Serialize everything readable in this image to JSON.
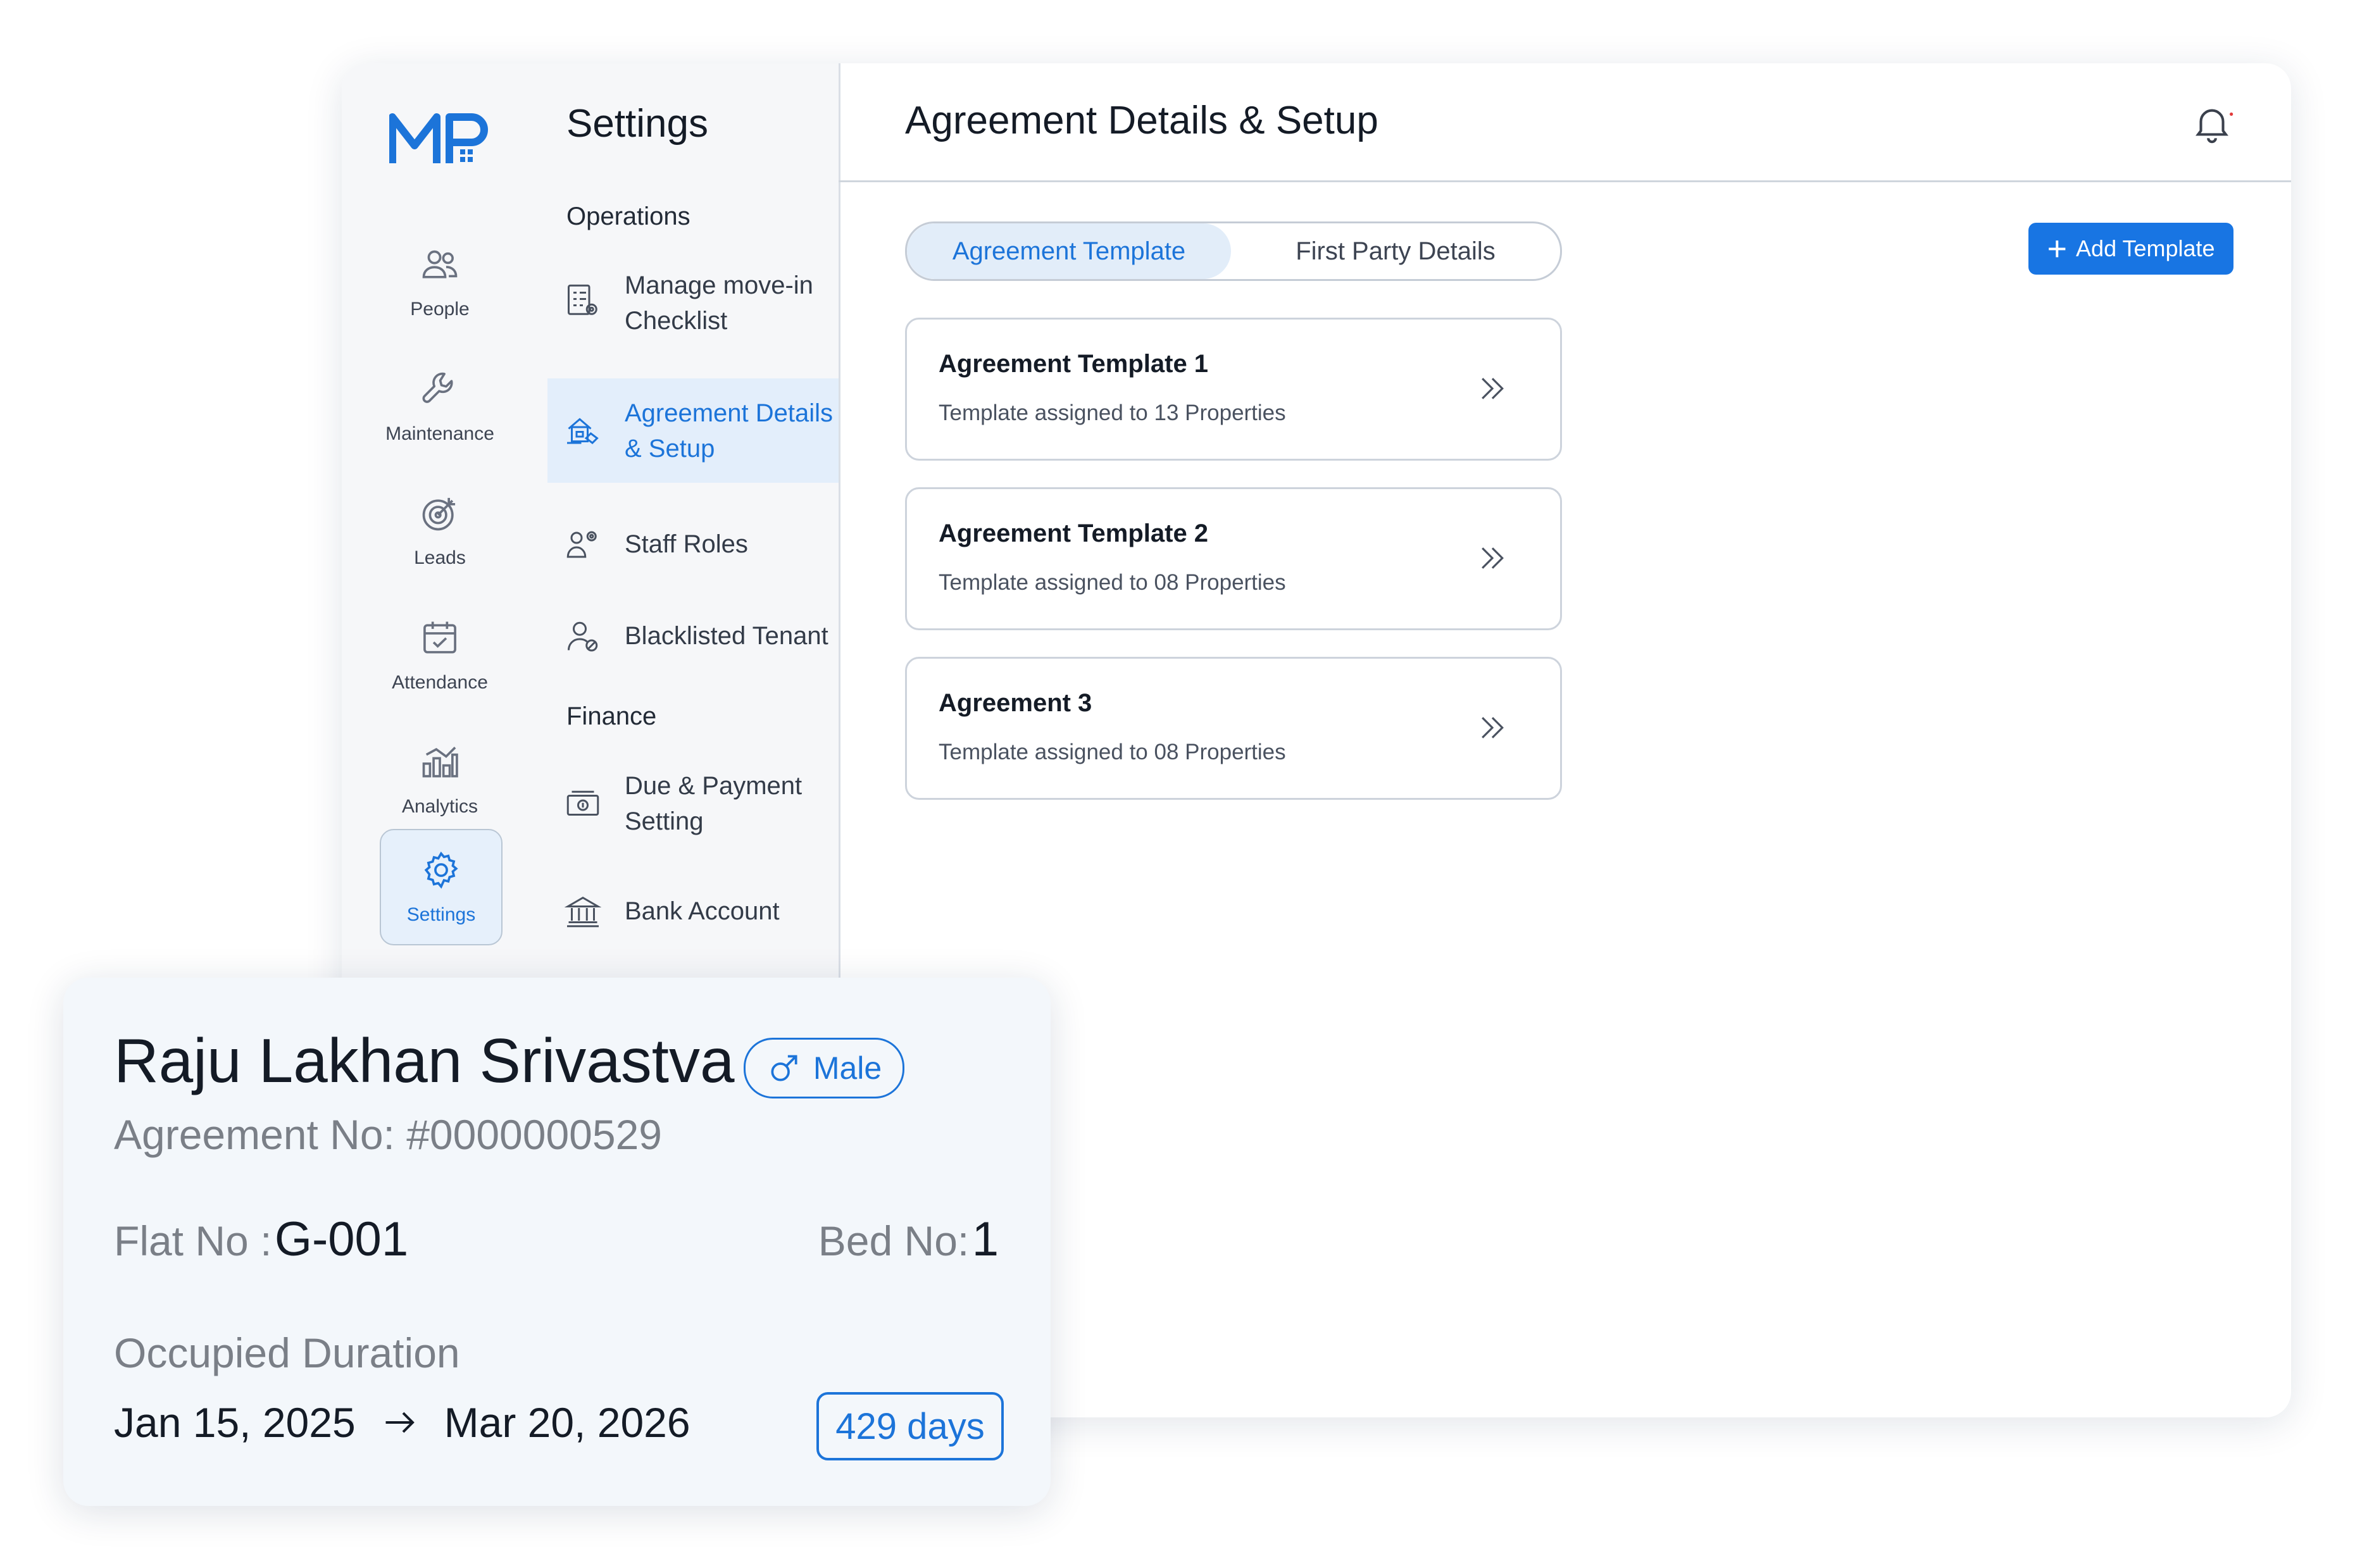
{
  "nav": {
    "logo_text": "MP",
    "items": [
      {
        "label": "People",
        "icon": "people-icon"
      },
      {
        "label": "Maintenance",
        "icon": "wrench-icon"
      },
      {
        "label": "Leads",
        "icon": "target-icon"
      },
      {
        "label": "Attendance",
        "icon": "calendar-check-icon"
      },
      {
        "label": "Analytics",
        "icon": "analytics-icon"
      },
      {
        "label": "Settings",
        "icon": "gear-icon",
        "active": true
      }
    ]
  },
  "settings": {
    "title": "Settings",
    "sections": [
      {
        "heading": "Operations"
      },
      {
        "heading": "Finance"
      }
    ],
    "items": [
      {
        "label": "Manage move-in Checklist",
        "icon": "checklist-icon"
      },
      {
        "label": "Agreement Details & Setup",
        "icon": "agreement-icon",
        "active": true
      },
      {
        "label": "Staff Roles",
        "icon": "staff-roles-icon"
      },
      {
        "label": "Blacklisted Tenant",
        "icon": "blacklisted-user-icon"
      },
      {
        "label": "Due & Payment Setting",
        "icon": "cash-icon"
      },
      {
        "label": "Bank Account",
        "icon": "bank-icon"
      }
    ]
  },
  "header": {
    "title": "Agreement Details & Setup",
    "bell_icon": "bell-icon",
    "notification_dot_color": "#e23b3b"
  },
  "tabs": [
    {
      "label": "Agreement Template",
      "active": true
    },
    {
      "label": "First Party Details",
      "active": false
    }
  ],
  "add_template_label": "Add Template",
  "templates": [
    {
      "title": "Agreement Template 1",
      "subtitle": "Template assigned to 13 Properties"
    },
    {
      "title": "Agreement Template 2",
      "subtitle": "Template assigned to 08 Properties"
    },
    {
      "title": "Agreement 3",
      "subtitle": "Template assigned to 08 Properties"
    }
  ],
  "tenant": {
    "name": "Raju Lakhan Srivastva",
    "gender": "Male",
    "agreement_no": "Agreement No: #0000000529",
    "flat_label": "Flat No :",
    "flat_value": "G-001",
    "bed_label": "Bed No:",
    "bed_value": "1",
    "occupied_label": "Occupied Duration",
    "start_date": "Jan 15, 2025",
    "end_date": "Mar 20, 2026",
    "days": "429 days"
  },
  "colors": {
    "accent": "#1c74d9",
    "button": "#1875e3",
    "active_bg": "#e3eefb"
  }
}
